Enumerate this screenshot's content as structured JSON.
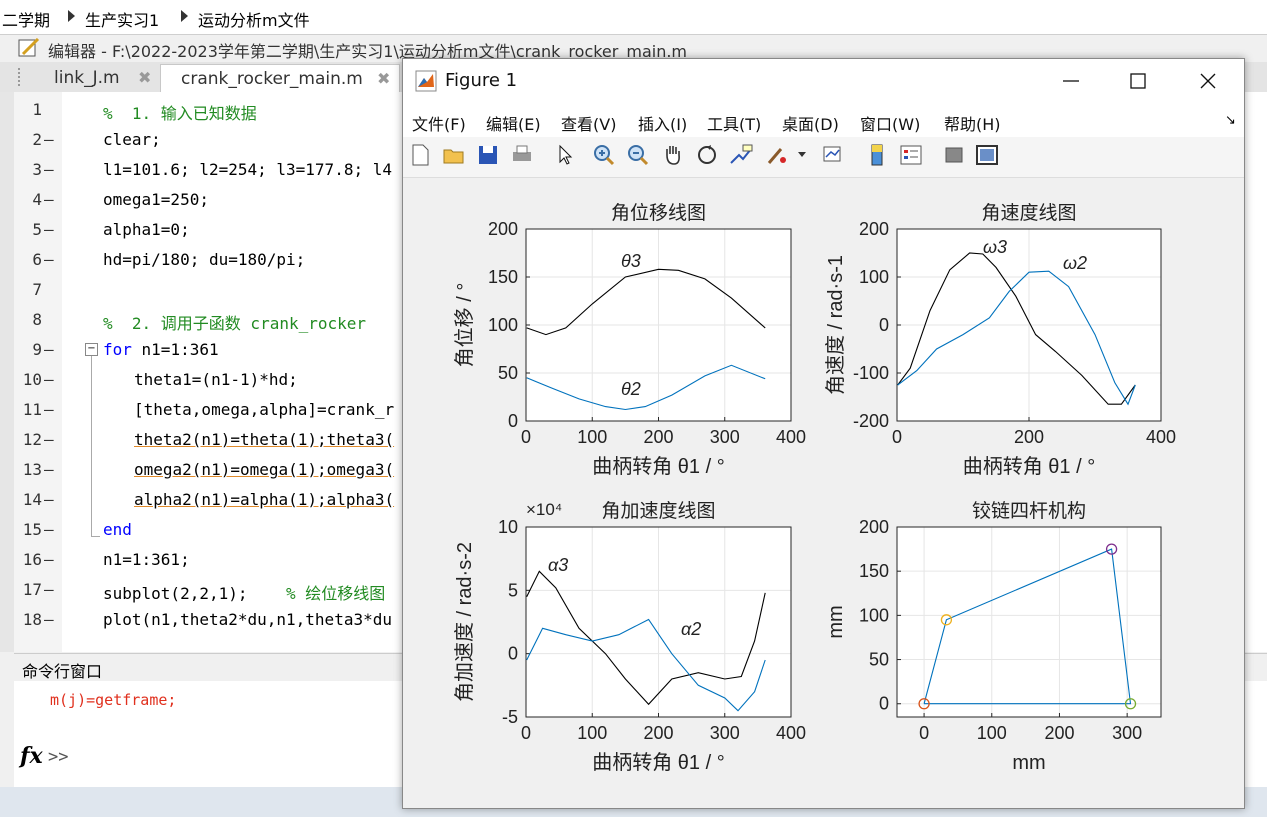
{
  "breadcrumb": [
    "二学期",
    "生产实习1",
    "运动分析m文件"
  ],
  "editor": {
    "title": "编辑器 - F:\\2022-2023学年第二学期\\生产实习1\\运动分析m文件\\crank_rocker_main.m",
    "tabs": [
      {
        "label": "link_J.m",
        "active": false
      },
      {
        "label": "crank_rocker_main.m",
        "active": true
      }
    ],
    "lines": [
      {
        "n": "1",
        "dash": "",
        "text": "%  1. 输入已知数据",
        "cls": "cm",
        "indent": 0
      },
      {
        "n": "2",
        "dash": "—",
        "text": "clear;",
        "cls": "",
        "indent": 0
      },
      {
        "n": "3",
        "dash": "—",
        "text": "l1=101.6; l2=254; l3=177.8; l4",
        "cls": "",
        "indent": 0
      },
      {
        "n": "4",
        "dash": "—",
        "text": "omega1=250;",
        "cls": "",
        "indent": 0
      },
      {
        "n": "5",
        "dash": "—",
        "text": "alpha1=0;",
        "cls": "",
        "indent": 0
      },
      {
        "n": "6",
        "dash": "—",
        "text": "hd=pi/180; du=180/pi;",
        "cls": "",
        "indent": 0
      },
      {
        "n": "7",
        "dash": "",
        "text": "",
        "cls": "",
        "indent": 0
      },
      {
        "n": "8",
        "dash": "",
        "text": "%  2. 调用子函数 crank_rocker",
        "cls": "cm",
        "indent": 0
      },
      {
        "n": "9",
        "dash": "—",
        "text": "for n1=1:361",
        "cls": "kwfirst",
        "indent": 0
      },
      {
        "n": "10",
        "dash": "—",
        "text": "theta1=(n1-1)*hd;",
        "cls": "",
        "indent": 1
      },
      {
        "n": "11",
        "dash": "—",
        "text": "[theta,omega,alpha]=crank_r",
        "cls": "",
        "indent": 1
      },
      {
        "n": "12",
        "dash": "—",
        "text": "theta2(n1)=theta(1);theta3(",
        "cls": "ul",
        "indent": 1
      },
      {
        "n": "13",
        "dash": "—",
        "text": "omega2(n1)=omega(1);omega3(",
        "cls": "ul",
        "indent": 1
      },
      {
        "n": "14",
        "dash": "—",
        "text": "alpha2(n1)=alpha(1);alpha3(",
        "cls": "ul",
        "indent": 1
      },
      {
        "n": "15",
        "dash": "—",
        "text": "end",
        "cls": "kw",
        "indent": 0
      },
      {
        "n": "16",
        "dash": "—",
        "text": "n1=1:361;",
        "cls": "",
        "indent": 0
      },
      {
        "n": "17",
        "dash": "—",
        "text": "subplot(2,2,1);    % 绘位移线图",
        "cls": "mixed",
        "indent": 0
      },
      {
        "n": "18",
        "dash": "—",
        "text": "plot(n1,theta2*du,n1,theta3*du",
        "cls": "",
        "indent": 0
      }
    ]
  },
  "command_window": {
    "title": "命令行窗口",
    "error_line": "m(j)=getframe;",
    "prompt": ">>",
    "fx_label": "fx"
  },
  "figure": {
    "title": "Figure 1",
    "menu": [
      "文件(F)",
      "编辑(E)",
      "查看(V)",
      "插入(I)",
      "工具(T)",
      "桌面(D)",
      "窗口(W)",
      "帮助(H)"
    ],
    "toolbar_icons": [
      "new-file-icon",
      "open-folder-icon",
      "save-icon",
      "print-icon",
      "pointer-icon",
      "zoom-in-icon",
      "zoom-out-icon",
      "pan-hand-icon",
      "rotate-icon",
      "data-cursor-icon",
      "brush-icon",
      "brush-dropdown-icon",
      "link-plot-icon",
      "colorbar-icon",
      "legend-icon",
      "hide-plot-tools-icon",
      "show-plot-tools-icon"
    ]
  },
  "chart_data": [
    {
      "type": "line",
      "title": "角位移线图",
      "xlabel": "曲柄转角 θ1 / °",
      "ylabel": "角位移 / °",
      "xlim": [
        0,
        400
      ],
      "ylim": [
        0,
        200
      ],
      "xticks": [
        "0",
        "100",
        "200",
        "300",
        "400"
      ],
      "yticks": [
        "0",
        "50",
        "100",
        "150",
        "200"
      ],
      "grid": true,
      "series": [
        {
          "name": "θ3",
          "color": "#000000",
          "x": [
            1,
            30,
            60,
            100,
            150,
            200,
            230,
            270,
            310,
            361
          ],
          "y": [
            97,
            90,
            97,
            122,
            150,
            158,
            157,
            148,
            128,
            97
          ]
        },
        {
          "name": "θ2",
          "color": "#0072bd",
          "x": [
            1,
            40,
            80,
            120,
            150,
            180,
            220,
            270,
            310,
            361
          ],
          "y": [
            45,
            34,
            23,
            15,
            12,
            15,
            27,
            47,
            58,
            44
          ]
        }
      ]
    },
    {
      "type": "line",
      "title": "角速度线图",
      "xlabel": "曲柄转角 θ1 / °",
      "ylabel": "角速度 / rad·s-1",
      "xlim": [
        0,
        400
      ],
      "ylim": [
        -200,
        200
      ],
      "xticks": [
        "0",
        "200",
        "400"
      ],
      "yticks": [
        "-200",
        "-100",
        "0",
        "100",
        "200"
      ],
      "grid": true,
      "series": [
        {
          "name": "ω3",
          "color": "#000000",
          "x": [
            1,
            20,
            50,
            80,
            110,
            130,
            150,
            180,
            210,
            240,
            280,
            320,
            340,
            361
          ],
          "y": [
            -125,
            -90,
            30,
            115,
            150,
            148,
            120,
            60,
            -20,
            -55,
            -105,
            -165,
            -165,
            -125
          ]
        },
        {
          "name": "ω2",
          "color": "#0072bd",
          "x": [
            1,
            30,
            60,
            100,
            140,
            170,
            200,
            230,
            260,
            300,
            330,
            350,
            361
          ],
          "y": [
            -125,
            -95,
            -50,
            -20,
            15,
            70,
            110,
            112,
            80,
            -20,
            -120,
            -165,
            -125
          ]
        }
      ]
    },
    {
      "type": "line",
      "title": "角加速度线图",
      "xlabel": "曲柄转角 θ1 / °",
      "ylabel": "角加速度 / rad·s-2",
      "exponent": "×10⁴",
      "xlim": [
        0,
        400
      ],
      "ylim": [
        -5,
        10
      ],
      "xticks": [
        "0",
        "100",
        "200",
        "300",
        "400"
      ],
      "yticks": [
        "-5",
        "0",
        "5",
        "10"
      ],
      "grid": true,
      "series": [
        {
          "name": "α3",
          "color": "#000000",
          "x": [
            1,
            20,
            45,
            80,
            120,
            150,
            185,
            220,
            260,
            300,
            325,
            345,
            361
          ],
          "y": [
            4.5,
            6.5,
            5.2,
            2,
            0,
            -2,
            -4,
            -2,
            -1.5,
            -2,
            -1.8,
            1,
            4.8
          ]
        },
        {
          "name": "α2",
          "color": "#0072bd",
          "x": [
            1,
            25,
            60,
            100,
            140,
            185,
            220,
            260,
            300,
            320,
            345,
            361
          ],
          "y": [
            -0.5,
            2,
            1.5,
            1,
            1.5,
            2.7,
            0,
            -2.5,
            -3.5,
            -4.5,
            -3,
            -0.5
          ]
        }
      ]
    },
    {
      "type": "line",
      "title": "铰链四杆机构",
      "xlabel": "mm",
      "ylabel": "mm",
      "xlim": [
        -40,
        350
      ],
      "ylim": [
        -15,
        200
      ],
      "xticks": [
        "0",
        "100",
        "200",
        "300"
      ],
      "yticks": [
        "0",
        "50",
        "100",
        "150",
        "200"
      ],
      "grid": true,
      "series": [
        {
          "name": "linkage",
          "color": "#0072bd",
          "x": [
            0,
            33,
            277,
            305,
            0
          ],
          "y": [
            0,
            95,
            175,
            0,
            0
          ]
        }
      ],
      "joints": [
        {
          "x": 0,
          "y": 0,
          "color": "#d95319"
        },
        {
          "x": 33,
          "y": 95,
          "color": "#edb120"
        },
        {
          "x": 277,
          "y": 175,
          "color": "#7e2f8e"
        },
        {
          "x": 305,
          "y": 0,
          "color": "#77ac30"
        }
      ]
    }
  ]
}
